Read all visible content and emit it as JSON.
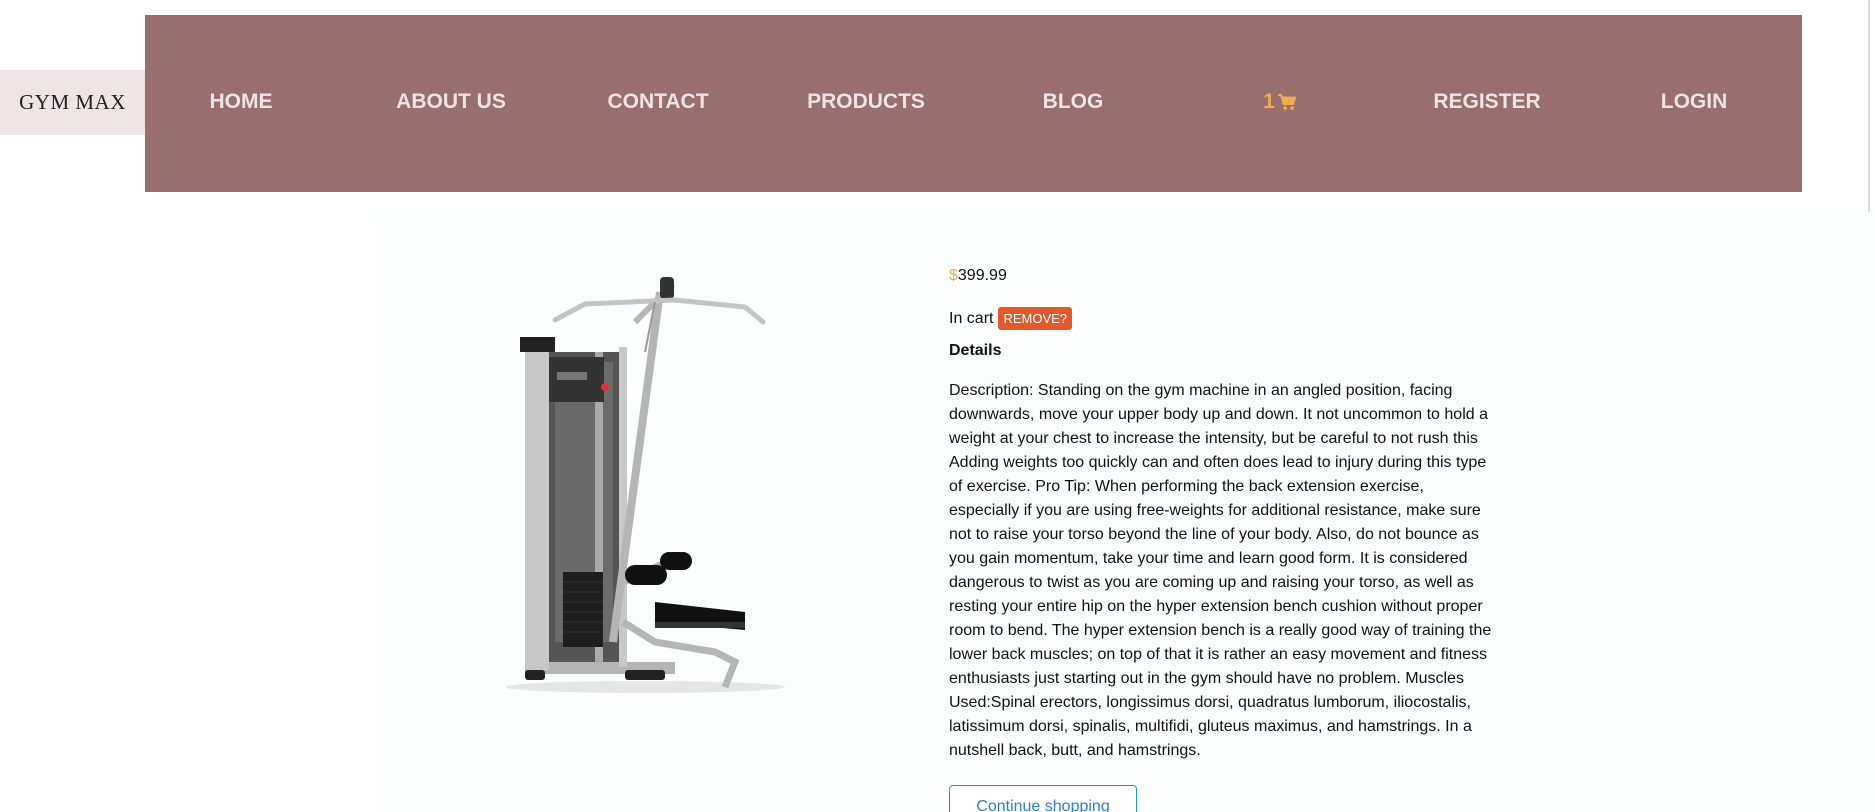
{
  "brand": {
    "name": "GYM MAX"
  },
  "nav": {
    "items": [
      {
        "label": "HOME"
      },
      {
        "label": "ABOUT US"
      },
      {
        "label": "CONTACT"
      },
      {
        "label": "PRODUCTS"
      },
      {
        "label": "BLOG"
      },
      {
        "label": "1",
        "icon": "cart-icon"
      },
      {
        "label": "REGISTER"
      },
      {
        "label": "LOGIN"
      }
    ]
  },
  "product": {
    "currency_symbol": "$",
    "price": "399.99",
    "in_cart_label": "In cart",
    "remove_label": "REMOVE?",
    "details_heading": "Details",
    "description": "Description: Standing on the gym machine in an angled position, facing downwards, move your upper body up and down. It not uncommon to hold a weight at your chest to increase the intensity, but be careful to not rush this Adding weights too quickly can and often does lead to injury during this type of exercise. Pro Tip: When performing the back extension exercise, especially if you are using free-weights for additional resistance, make sure not to raise your torso beyond the line of your body. Also, do not bounce as you gain momentum, take your time and learn good form. It is considered dangerous to twist as you are coming up and raising your torso, as well as resting your entire hip on the hyper extension bench cushion without proper room to bend. The hyper extension bench is a really good way of training the lower back muscles; on top of that it is rather an easy movement and fitness enthusiasts just starting out in the gym should have no problem. Muscles Used:Spinal erectors, longissimus dorsi, quadratus lumborum, iliocostalis, latissimum dorsi, spinalis, multifidi, gluteus maximus, and hamstrings. In a nutshell back, butt, and hamstrings.",
    "continue_label": "Continue shopping"
  },
  "colors": {
    "navbar": "#986e6e",
    "nav_text": "#efe4e4",
    "cart_accent": "#f0ad4e",
    "remove_button": "#e05a2b",
    "continue_border": "#17a2b8"
  }
}
